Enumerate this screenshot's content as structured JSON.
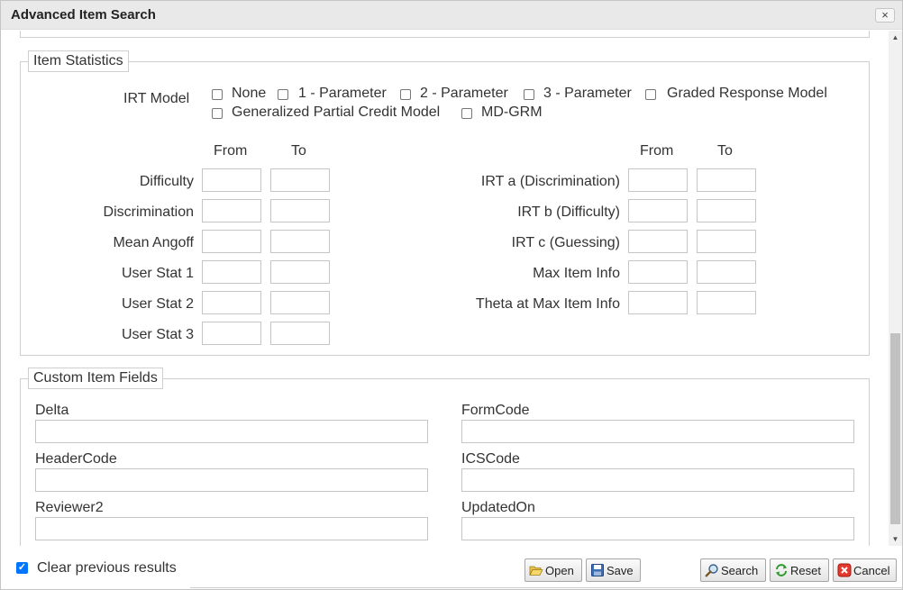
{
  "window": {
    "title": "Advanced Item Search",
    "close": "×"
  },
  "item_statistics": {
    "legend": "Item Statistics",
    "irt_label": "IRT Model",
    "irt_options": [
      "None",
      "1 - Parameter",
      "2 - Parameter",
      "3 - Parameter",
      "Graded Response Model",
      "Generalized Partial Credit Model",
      "MD-GRM"
    ],
    "from": "From",
    "to": "To",
    "left_stats": [
      "Difficulty",
      "Discrimination",
      "Mean Angoff",
      "User Stat 1",
      "User Stat 2",
      "User Stat 3"
    ],
    "right_stats": [
      "IRT a (Discrimination)",
      "IRT b (Difficulty)",
      "IRT c (Guessing)",
      "Max Item Info",
      "Theta at Max Item Info"
    ]
  },
  "custom_fields": {
    "legend": "Custom Item Fields",
    "fields": [
      "Delta",
      "FormCode",
      "HeaderCode",
      "ICSCode",
      "Reviewer2",
      "UpdatedOn"
    ]
  },
  "footer": {
    "clear_previous": "Clear previous results",
    "clear_checked": true,
    "open": "Open",
    "save": "Save",
    "search": "Search",
    "reset": "Reset",
    "cancel": "Cancel"
  }
}
